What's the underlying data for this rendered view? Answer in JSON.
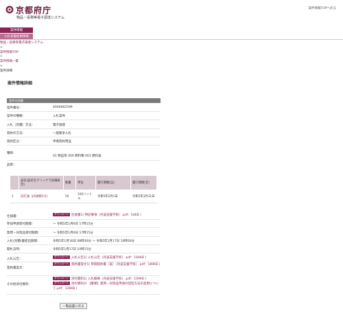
{
  "header": {
    "logo_text": "京都府庁",
    "subtitle": "物品・役務等電子調達システム",
    "top_link": "案件情報TOPへ戻る"
  },
  "menu": {
    "item1": "案件情報",
    "item2": "入札実施結果情報"
  },
  "breadcrumb": {
    "home": "物品・役務等電子調達システム",
    "sep1": ">",
    "top": "案件情報TOP",
    "sep2": ">",
    "list": "案件情報一覧",
    "sep3": ">",
    "current": "案件詳細"
  },
  "page_title": "案件情報詳細",
  "section_title": "案件の詳細",
  "details": {
    "case_no_label": "案件番号：",
    "case_no": "4000062599",
    "case_type_label": "案件の種類：",
    "case_type": "入札案件",
    "bid_method_label": "入札（見積）方法：",
    "bid_method": "電子調達",
    "contract_method_label": "契約の方法：",
    "contract_method": "一般競争入札",
    "contract_category_label": "契約区分：",
    "contract_category": "単価契約用品",
    "item_type_label": "種目：",
    "item_type": "01  物品等  009  燃料類  001  燃料油",
    "products_label": "品目："
  },
  "items_table": {
    "headers": [
      "",
      "品名(品名をクリックで詳細表示)",
      "数量",
      "単位",
      "履行期間(自)",
      "履行期間(至)"
    ],
    "rows": [
      {
        "no": "1",
        "name": "白灯油（JIS規格1号）",
        "qty": "50",
        "unit": "100リットル",
        "from": "令和5年2月1日",
        "to": "令和5年3月31日"
      }
    ]
  },
  "docs": {
    "spec_label": "仕様書：",
    "badge": "ダウンロード",
    "spec_file": "仕様書1( 特記事項（丹波支援学校）.pdf：54KB )",
    "participation_label": "参加申請受付期間：",
    "participation": "～ 令和5年1月6日 17時15分",
    "question_label": "質問・同等品受付期間：",
    "question": "～ 令和5年1月6日 17時15分",
    "bid_period_label": "入札(見積)書提出期間：",
    "bid_period": "令和5年1月16日 08時30分 ～ 令和5年1月17日 10時00分",
    "opening_label": "開札日時：",
    "opening": "令和5年1月17日 10時15分",
    "notice_label": "入札公告：",
    "notice_file": "入札公告1( 入札公告（丹波支援学校）.pdf：184KB )",
    "contract_label": "契約書案文：",
    "contract_file": "契約書案文1( 単価契約書（案）（丹波支援学校）.pdf：189KB )",
    "other_label": "その他添付資料：",
    "other_file1": "添付資料1( 入札概要（丹波支援学校）.pdf：109KB )",
    "other_file2": "添付資料2( 【重要】質問・同等品申請の回答方法の変更について.pdf：336KB )"
  },
  "buttons": {
    "back": "一覧画面に戻る"
  },
  "colors": {
    "brand": "#8a2453",
    "menu_light": "#b76d8f",
    "table_header": "#d8c9d0",
    "section_bar": "#7a7a7a"
  }
}
